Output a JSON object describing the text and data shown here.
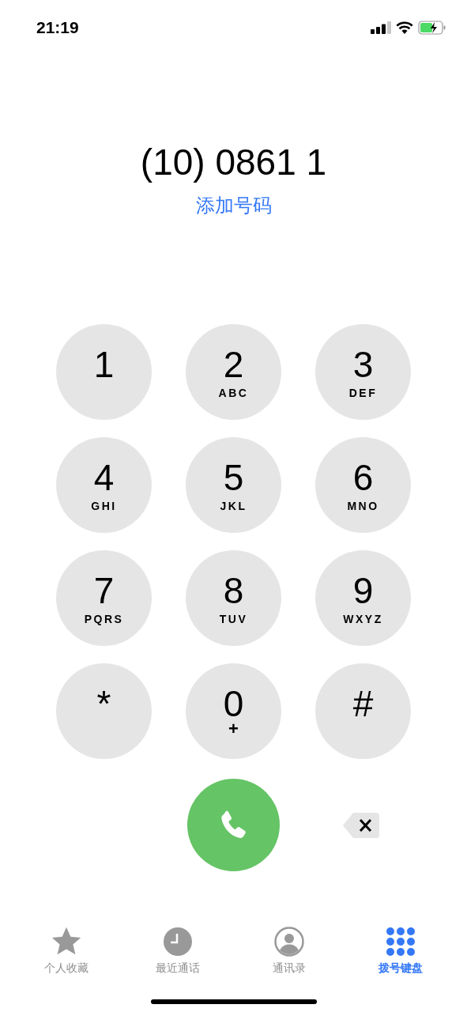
{
  "status_bar": {
    "time": "21:19"
  },
  "number": "(10) 0861 1",
  "add_number": "添加号码",
  "keys": [
    {
      "digit": "1"
    },
    {
      "digit": "2",
      "letters": "ABC"
    },
    {
      "digit": "3",
      "letters": "DEF"
    },
    {
      "digit": "4",
      "letters": "GHI"
    },
    {
      "digit": "5",
      "letters": "JKL"
    },
    {
      "digit": "6",
      "letters": "MNO"
    },
    {
      "digit": "7",
      "letters": "PQRS"
    },
    {
      "digit": "8",
      "letters": "TUV"
    },
    {
      "digit": "9",
      "letters": "WXYZ"
    },
    {
      "digit": "*"
    },
    {
      "digit": "0",
      "letters": "+"
    },
    {
      "digit": "#"
    }
  ],
  "tabs": [
    {
      "kind": "favorites",
      "label": "个人收藏",
      "selected": false
    },
    {
      "kind": "recents",
      "label": "最近通话",
      "selected": false
    },
    {
      "kind": "contacts",
      "label": "通讯录",
      "selected": false
    },
    {
      "kind": "keypad",
      "label": "拨号键盘",
      "selected": true
    }
  ]
}
